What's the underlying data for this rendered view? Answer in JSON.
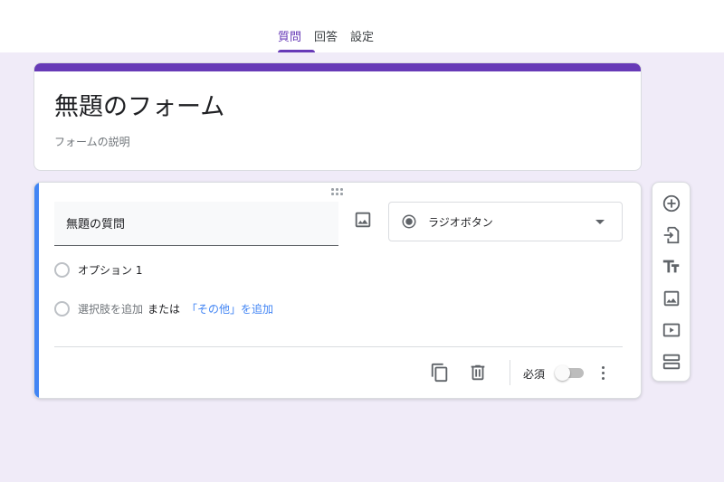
{
  "tabs": [
    {
      "label": "質問",
      "active": true
    },
    {
      "label": "回答",
      "active": false
    },
    {
      "label": "設定",
      "active": false
    }
  ],
  "form": {
    "title": "無題のフォーム",
    "description": "フォームの説明"
  },
  "question": {
    "title": "無題の質問",
    "type_label": "ラジオボタン",
    "options": [
      {
        "label": "オプション 1"
      }
    ],
    "add_option_label": "選択肢を追加",
    "or_label": "または",
    "add_other_label": "「その他」を追加",
    "required_label": "必須",
    "required": false
  },
  "icons": {
    "image": "image-icon",
    "radio": "radio-button-icon",
    "duplicate": "copy-icon",
    "delete": "trash-icon",
    "more": "more-vert-icon",
    "add_question": "add-circle-icon",
    "import": "import-icon",
    "title_text": "title-text-icon",
    "add_image": "image-icon",
    "add_video": "video-icon",
    "add_section": "section-icon"
  },
  "colors": {
    "accent": "#673ab7",
    "focus": "#4285f4",
    "background": "#f0ebf8"
  }
}
